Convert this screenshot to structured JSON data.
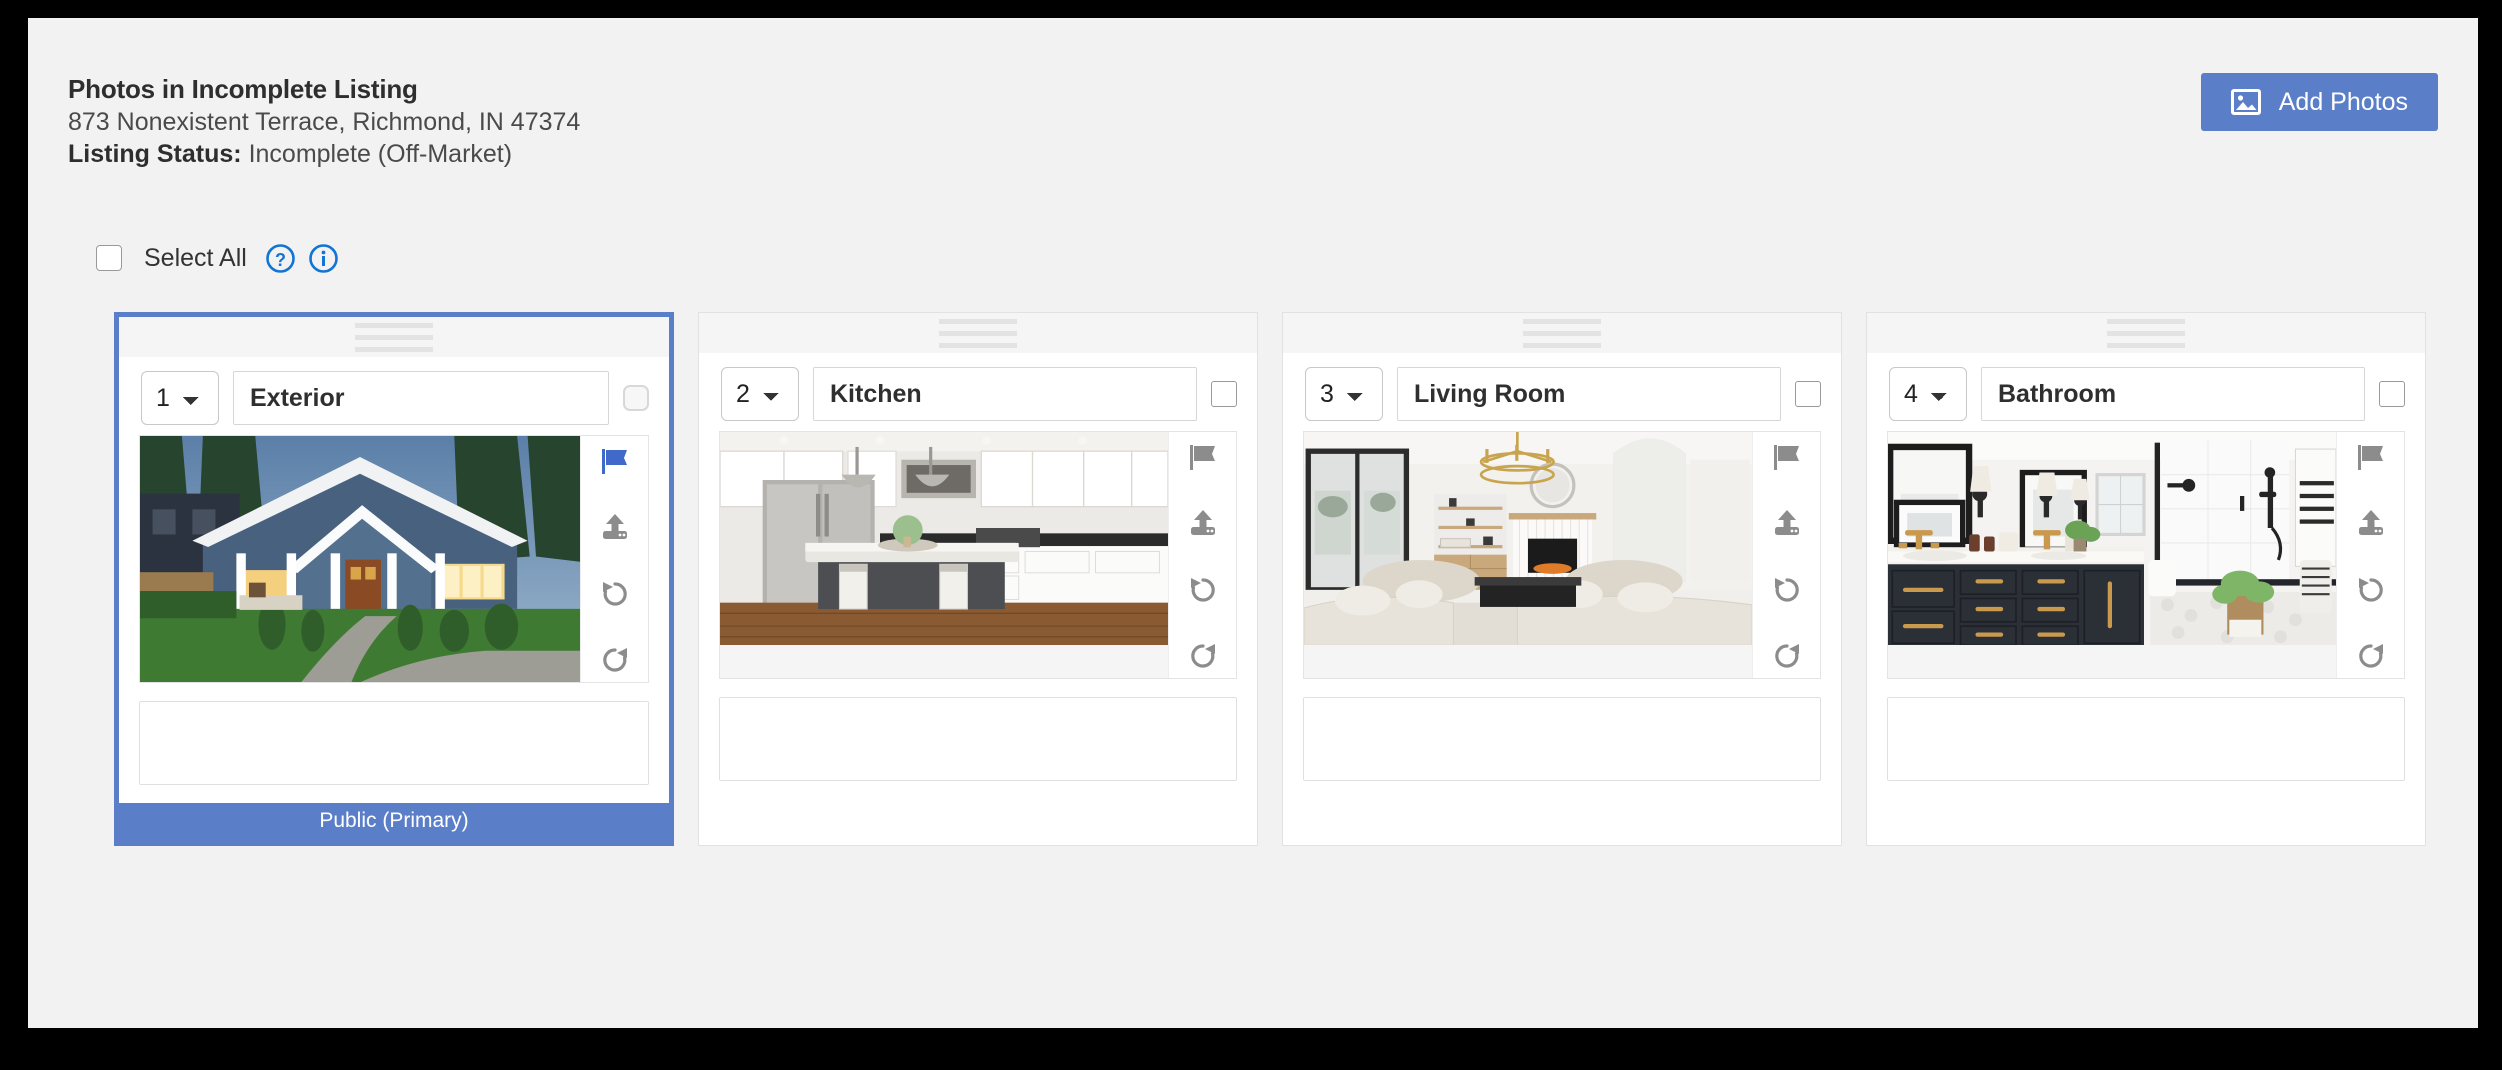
{
  "header": {
    "title": "Photos in Incomplete Listing",
    "address": "873 Nonexistent Terrace, Richmond, IN 47374",
    "status_label": "Listing Status:",
    "status_value": "Incomplete (Off-Market)",
    "add_photos_label": "Add Photos",
    "add_photos_icon": "image-icon",
    "accent_color": "#5b7ec9"
  },
  "toolbar": {
    "select_all_label": "Select All",
    "help_icon": "question-circle-icon",
    "info_icon": "info-circle-icon"
  },
  "cards": [
    {
      "order": "1",
      "label": "Exterior",
      "caption": "",
      "selected": true,
      "flagged": true,
      "visibility": "Public (Primary)",
      "photo": "exterior-house-photo"
    },
    {
      "order": "2",
      "label": "Kitchen",
      "caption": "",
      "selected": false,
      "flagged": false,
      "visibility": "",
      "photo": "kitchen-photo"
    },
    {
      "order": "3",
      "label": "Living Room",
      "caption": "",
      "selected": false,
      "flagged": false,
      "visibility": "",
      "photo": "living-room-photo"
    },
    {
      "order": "4",
      "label": "Bathroom",
      "caption": "",
      "selected": false,
      "flagged": false,
      "visibility": "",
      "photo": "bathroom-photo"
    }
  ],
  "card_tools": {
    "flag": "flag-icon",
    "upload": "upload-icon",
    "rotate_left": "rotate-left-icon",
    "rotate_right": "rotate-right-icon",
    "delete": "trash-icon"
  },
  "order_options": [
    "1",
    "2",
    "3",
    "4"
  ]
}
